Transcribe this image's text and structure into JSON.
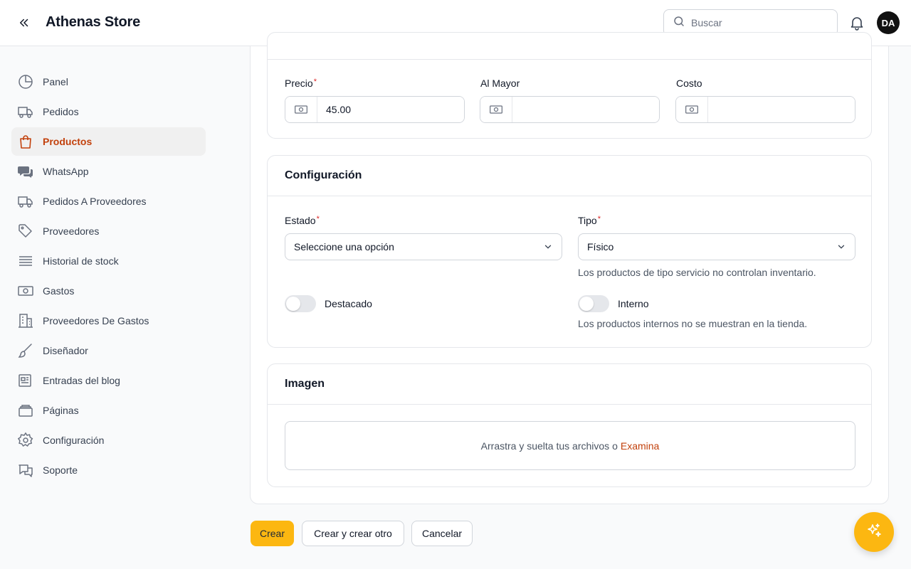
{
  "header": {
    "title": "Athenas Store",
    "search_placeholder": "Buscar",
    "avatar_initials": "DA"
  },
  "sidebar": {
    "items": [
      {
        "label": "Panel",
        "icon": "chart-pie-icon"
      },
      {
        "label": "Pedidos",
        "icon": "truck-icon"
      },
      {
        "label": "Productos",
        "icon": "shopping-bag-icon",
        "active": true
      },
      {
        "label": "WhatsApp",
        "icon": "chat-bubbles-icon"
      },
      {
        "label": "Pedidos A Proveedores",
        "icon": "truck-icon"
      },
      {
        "label": "Proveedores",
        "icon": "tag-icon"
      },
      {
        "label": "Historial de stock",
        "icon": "list-icon"
      },
      {
        "label": "Gastos",
        "icon": "banknotes-icon"
      },
      {
        "label": "Proveedores De Gastos",
        "icon": "building-icon"
      },
      {
        "label": "Diseñador",
        "icon": "paint-brush-icon"
      },
      {
        "label": "Entradas del blog",
        "icon": "newspaper-icon"
      },
      {
        "label": "Páginas",
        "icon": "pages-icon"
      },
      {
        "label": "Configuración",
        "icon": "cog-icon"
      },
      {
        "label": "Soporte",
        "icon": "chat-support-icon"
      }
    ]
  },
  "pricing": {
    "price_label": "Precio",
    "price_value": "45.00",
    "wholesale_label": "Al Mayor",
    "wholesale_value": "",
    "cost_label": "Costo",
    "cost_value": ""
  },
  "config": {
    "title": "Configuración",
    "status_label": "Estado",
    "status_value": "Seleccione una opción",
    "type_label": "Tipo",
    "type_value": "Físico",
    "type_hint": "Los productos de tipo servicio no controlan inventario.",
    "featured_label": "Destacado",
    "featured_on": false,
    "internal_label": "Interno",
    "internal_on": false,
    "internal_hint": "Los productos internos no se muestran en la tienda."
  },
  "image": {
    "title": "Imagen",
    "dropzone_text": "Arrastra y suelta tus archivos o",
    "browse_text": "Examina"
  },
  "actions": {
    "create": "Crear",
    "create_another": "Crear y crear otro",
    "cancel": "Cancelar"
  },
  "colors": {
    "accent": "#c2410c",
    "primary_button": "#fcb711"
  }
}
